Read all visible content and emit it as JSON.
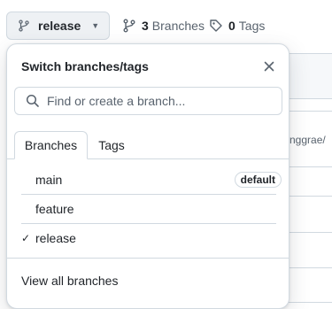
{
  "toolbar": {
    "branch_button_label": "release",
    "branches_count": "3",
    "branches_label": "Branches",
    "tags_count": "0",
    "tags_label": "Tags"
  },
  "background": {
    "partial_text": "nggrae/"
  },
  "dropdown": {
    "title": "Switch branches/tags",
    "search_placeholder": "Find or create a branch...",
    "tabs": [
      {
        "label": "Branches",
        "active": true
      },
      {
        "label": "Tags",
        "active": false
      }
    ],
    "branches": [
      {
        "name": "main",
        "badge": "default",
        "selected": false
      },
      {
        "name": "feature",
        "badge": "",
        "selected": false
      },
      {
        "name": "release",
        "badge": "",
        "selected": true
      }
    ],
    "selected_mark": "✓",
    "footer_link": "View all branches"
  },
  "icons": {
    "branch_button_icon": "git-branch-icon",
    "caret": "triangle-down-icon",
    "branches_meta_icon": "git-branch-icon",
    "tags_meta_icon": "tag-icon",
    "close": "x-icon",
    "search": "search-icon"
  },
  "colors": {
    "border": "#d1d9e0",
    "button_bg": "#eef1f4",
    "muted_text": "#59636e",
    "text": "#1f2328"
  }
}
